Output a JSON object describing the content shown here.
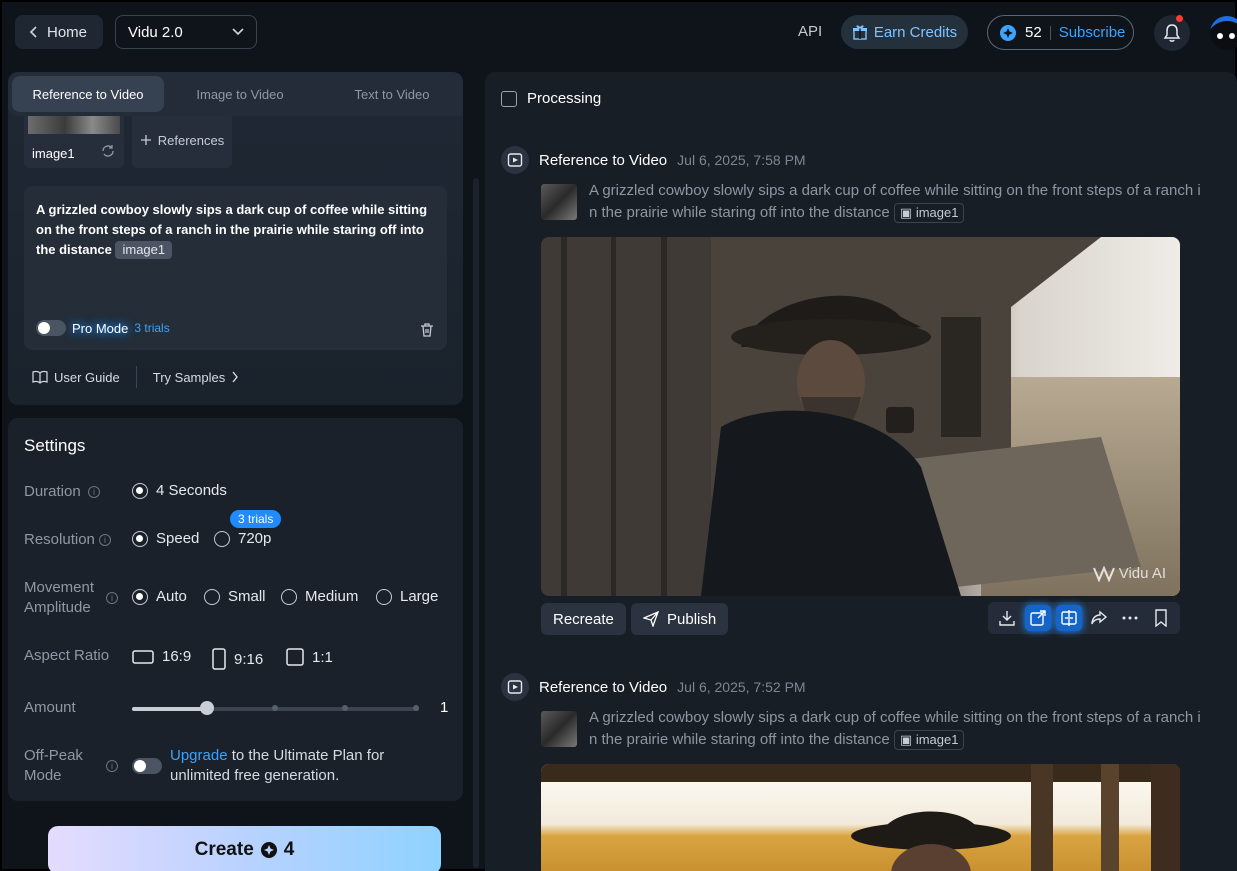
{
  "topbar": {
    "home_label": "Home",
    "model_value": "Vidu 2.0",
    "api_label": "API",
    "earn_credits_label": "Earn Credits",
    "credits_count": "52",
    "subscribe_label": "Subscribe"
  },
  "left": {
    "tabs": [
      {
        "label": "Reference to Video"
      },
      {
        "label": "Image to Video"
      },
      {
        "label": "Text to Video"
      }
    ],
    "reference_image_label": "image1",
    "add_references_label": "References",
    "prompt_text": "A grizzled cowboy slowly sips a dark cup of coffee while sitting on the front steps of a ranch in the prairie while staring off into the distance",
    "prompt_chip": "image1",
    "pro_mode_label": "Pro Mode",
    "pro_mode_trials": "3 trials",
    "user_guide_label": "User Guide",
    "try_samples_label": "Try Samples"
  },
  "settings": {
    "title": "Settings",
    "duration": {
      "label": "Duration",
      "options": [
        "4 Seconds"
      ],
      "selected": "4 Seconds"
    },
    "resolution": {
      "label": "Resolution",
      "options": [
        "Speed",
        "720p"
      ],
      "selected": "Speed",
      "badge": "3 trials"
    },
    "movement": {
      "label_line1": "Movement",
      "label_line2": "Amplitude",
      "options": [
        "Auto",
        "Small",
        "Medium",
        "Large"
      ],
      "selected": "Auto"
    },
    "aspect": {
      "label": "Aspect Ratio",
      "options": [
        "16:9",
        "9:16",
        "1:1"
      ]
    },
    "amount": {
      "label": "Amount",
      "value": "1",
      "slider_fraction": 0.26
    },
    "offpeak": {
      "label_line1": "Off-Peak",
      "label_line2": "Mode",
      "link": "Upgrade",
      "text_line1_rest": " to the Ultimate Plan for",
      "text_line2": "unlimited free generation."
    },
    "create_label": "Create",
    "create_cost": "4"
  },
  "right": {
    "processing_label": "Processing",
    "entries": [
      {
        "title": "Reference to Video",
        "date": "Jul 6, 2025, 7:58 PM",
        "prompt_line1": "A grizzled cowboy slowly sips a dark cup of coffee while sitting on the front steps of a ranch i",
        "prompt_line2": "n the prairie while staring off into the distance",
        "chip": "image1",
        "watermark": "Vidu AI",
        "recreate_label": "Recreate",
        "publish_label": "Publish"
      },
      {
        "title": "Reference to Video",
        "date": "Jul 6, 2025, 7:52 PM",
        "prompt_line1": "A grizzled cowboy slowly sips a dark cup of coffee while sitting on the front steps of a ranch i",
        "prompt_line2": "n the prairie while staring off into the distance",
        "chip": "image1"
      }
    ]
  }
}
